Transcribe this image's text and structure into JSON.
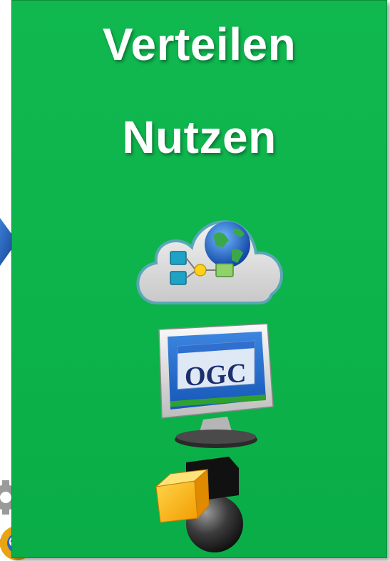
{
  "panel": {
    "title_line1": "Verteilen",
    "title_line2": "Nutzen",
    "background_color": "#0cb24a"
  },
  "icons": {
    "cloud": "cloud-network-globe-icon",
    "monitor": "ogc-monitor-icon",
    "database": "cube-sphere-icon",
    "arrow": "right-arrow-icon",
    "gear": "gear-icon"
  },
  "monitor_label": "OGC"
}
